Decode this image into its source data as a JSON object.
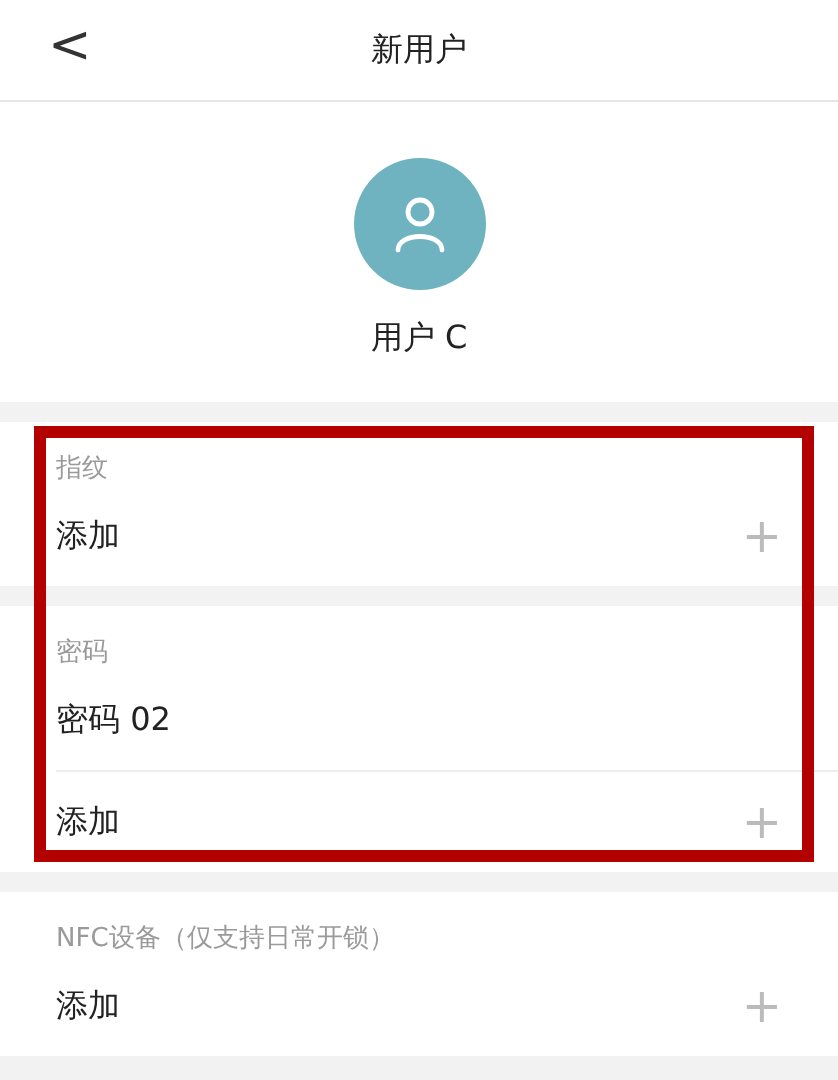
{
  "header": {
    "back": "<",
    "title": "新用户"
  },
  "profile": {
    "name": "用户 C"
  },
  "sections": [
    {
      "label": "指纹",
      "highlighted": true,
      "rows": [
        {
          "kind": "add",
          "text": "添加",
          "icon": "+"
        }
      ]
    },
    {
      "label": "密码",
      "highlighted": true,
      "rows": [
        {
          "kind": "item",
          "text": "密码 02"
        },
        {
          "kind": "add",
          "text": "添加",
          "icon": "+"
        }
      ]
    },
    {
      "label": "NFC设备（仅支持日常开锁）",
      "highlighted": false,
      "rows": [
        {
          "kind": "add",
          "text": "添加",
          "icon": "+"
        }
      ]
    }
  ]
}
